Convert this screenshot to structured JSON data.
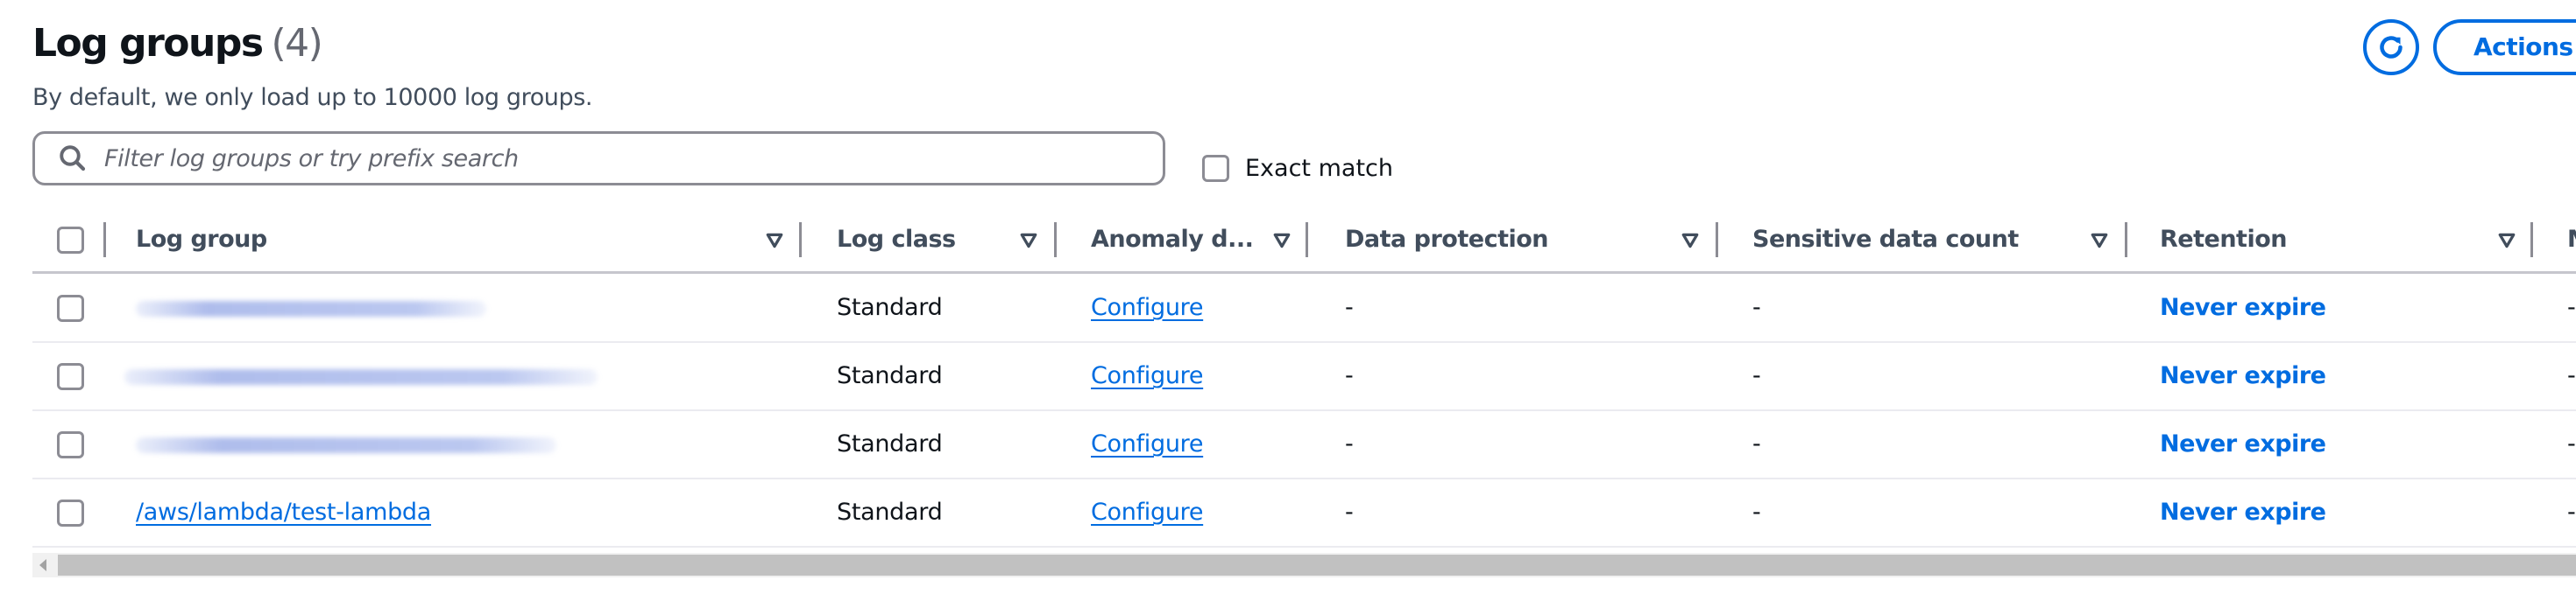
{
  "header": {
    "title": "Log groups",
    "count": "(4)",
    "subtitle": "By default, we only load up to 10000 log groups.",
    "refresh_icon": "refresh-icon",
    "actions_label": "Actions"
  },
  "filter": {
    "search_icon": "search-icon",
    "placeholder": "Filter log groups or try prefix search",
    "value": "",
    "exact_match_label": "Exact match",
    "exact_match_checked": false
  },
  "table": {
    "columns": [
      {
        "label": "Log group",
        "filter_icon": "filter-triangle-icon"
      },
      {
        "label": "Log class",
        "filter_icon": "filter-triangle-icon"
      },
      {
        "label": "Anomaly d...",
        "filter_icon": "filter-triangle-icon"
      },
      {
        "label": "Data protection",
        "filter_icon": "filter-triangle-icon"
      },
      {
        "label": "Sensitive data count",
        "filter_icon": "filter-triangle-icon"
      },
      {
        "label": "Retention",
        "filter_icon": "filter-triangle-icon"
      },
      {
        "label": "M"
      }
    ],
    "rows": [
      {
        "log_group": "",
        "redacted": true,
        "log_class": "Standard",
        "anomaly": "Configure",
        "data_protection": "-",
        "sensitive_count": "-",
        "retention": "Never expire",
        "next": "-"
      },
      {
        "log_group": "",
        "redacted": true,
        "log_class": "Standard",
        "anomaly": "Configure",
        "data_protection": "-",
        "sensitive_count": "-",
        "retention": "Never expire",
        "next": "-"
      },
      {
        "log_group": "",
        "redacted": true,
        "log_class": "Standard",
        "anomaly": "Configure",
        "data_protection": "-",
        "sensitive_count": "-",
        "retention": "Never expire",
        "next": "-"
      },
      {
        "log_group": "/aws/lambda/test-lambda",
        "redacted": false,
        "log_class": "Standard",
        "anomaly": "Configure",
        "data_protection": "-",
        "sensitive_count": "-",
        "retention": "Never expire",
        "next": "-"
      }
    ]
  },
  "colors": {
    "accent": "#006ce0",
    "text": "#0f141a",
    "muted": "#414d5c",
    "border": "#8c8c94"
  }
}
